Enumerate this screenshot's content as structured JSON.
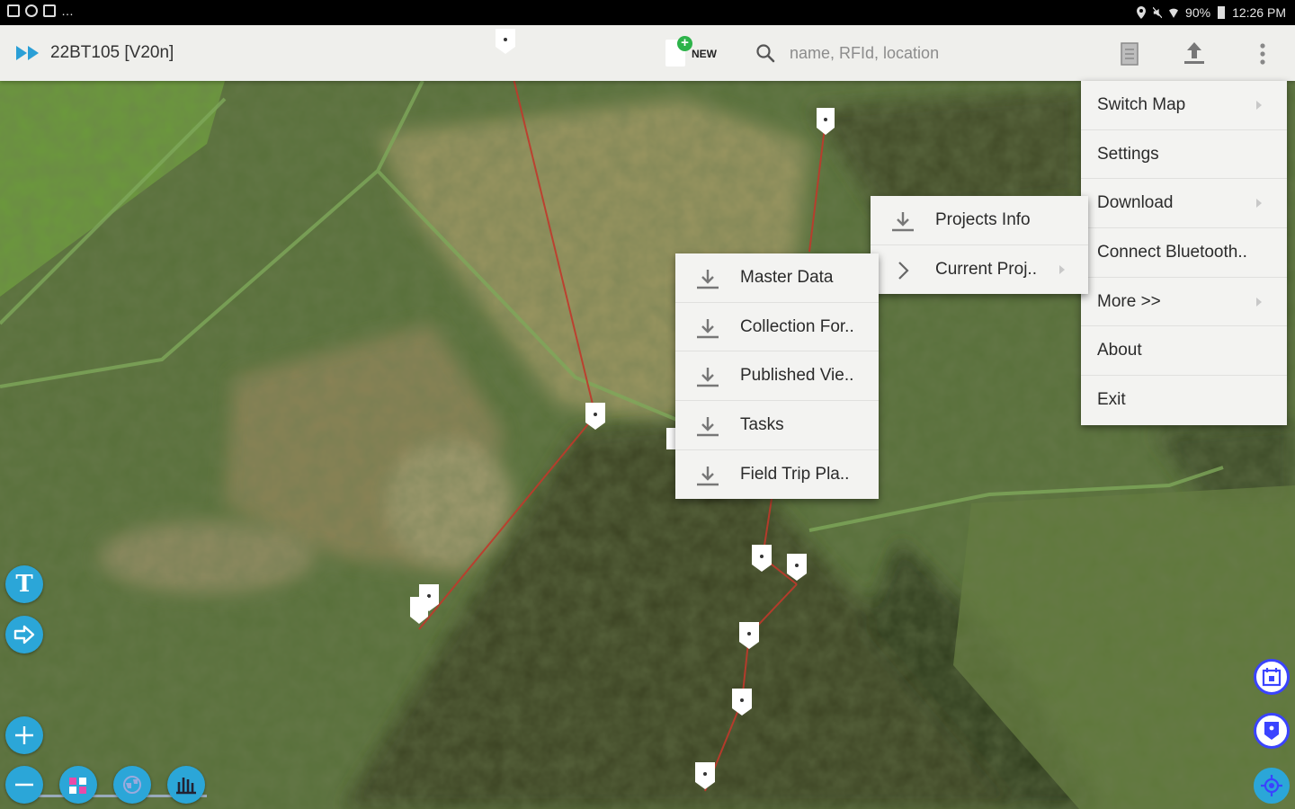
{
  "status_bar": {
    "battery": "90%",
    "time": "12:26 PM"
  },
  "toolbar": {
    "title": "22BT105 [V20n]",
    "new_label": "NEW",
    "search_placeholder": "name, RFId, location"
  },
  "main_menu": [
    {
      "label": "Switch Map",
      "has_submenu": true
    },
    {
      "label": "Settings",
      "has_submenu": false
    },
    {
      "label": "Download",
      "has_submenu": true
    },
    {
      "label": "Connect Bluetooth..",
      "has_submenu": false
    },
    {
      "label": "More >>",
      "has_submenu": true
    },
    {
      "label": "About",
      "has_submenu": false
    },
    {
      "label": "Exit",
      "has_submenu": false
    }
  ],
  "download_submenu": [
    {
      "label": "Projects Info",
      "icon": "download-icon"
    },
    {
      "label": "Current Proj..",
      "icon": "chevron-right-icon",
      "has_submenu": true
    }
  ],
  "current_project_submenu": [
    {
      "label": "Master Data",
      "icon": "download-icon"
    },
    {
      "label": "Collection For..",
      "icon": "download-icon"
    },
    {
      "label": "Published Vie..",
      "icon": "download-icon"
    },
    {
      "label": "Tasks",
      "icon": "download-icon"
    },
    {
      "label": "Field Trip Pla..",
      "icon": "download-icon"
    }
  ],
  "map_controls": {
    "left": [
      "text-tool-icon",
      "navigate-arrow-icon",
      "zoom-in-icon",
      "zoom-out-icon",
      "layers-icon",
      "globe-icon",
      "ruler-icon"
    ],
    "right": [
      "calendar-icon",
      "add-marker-icon",
      "my-location-icon"
    ]
  },
  "colors": {
    "toolbar_bg": "#efefec",
    "accent": "#2ba6d8",
    "route": "#c0392b",
    "right_button_border": "#3a43ff"
  }
}
